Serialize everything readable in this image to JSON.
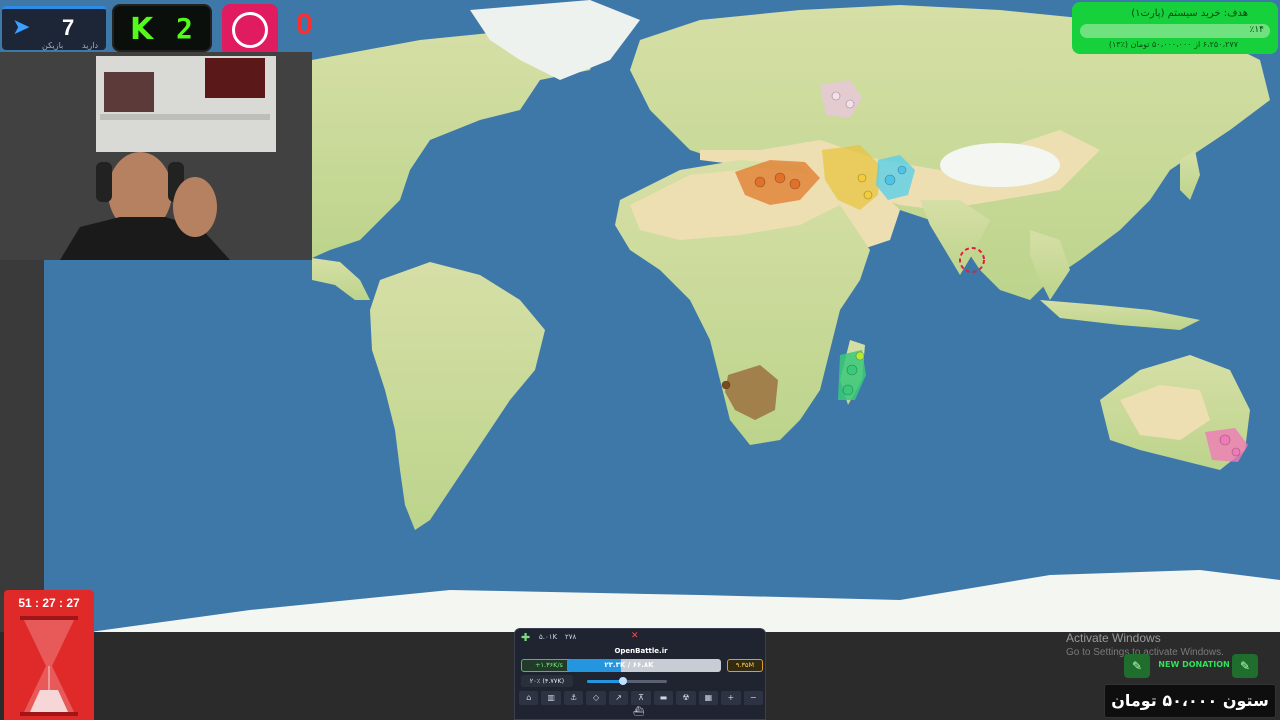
{
  "stream": {
    "viewer_count": "7",
    "viewer_label_1": "بازیکن",
    "viewer_label_2": "دارید",
    "kick_letter": "K",
    "kick_count": "2",
    "patreon_count": "0"
  },
  "goal": {
    "title": "هدف: خرید سیستم (پارت۱)",
    "percent": "٪۱۴",
    "amount": "۶،۲۵۰،۲۷۷ از ۵۰،۰۰۰،۰۰۰ تومان (٪۱۳)",
    "progress": 0.13
  },
  "timer": {
    "text": "51 : 27 : 27"
  },
  "game_panel": {
    "top_left_value": "۵.۰۱K",
    "top_mid_value": "۲۷۸",
    "close_glyph": "✕",
    "title": "OpenBattle.ir",
    "gold_rate": "+۱.۳۶K/s",
    "troops": "۲۳.۳K / ۶۶.۸K",
    "troops_fraction": 0.35,
    "gold": "۹.۳۵M",
    "attack_ratio": "۲۰٪ (۴.۷۷K)",
    "slider_fraction": 0.45
  },
  "watermark": {
    "line1": "Activate Windows",
    "line2": "Go to Settings to activate Windows."
  },
  "donation": {
    "label": "NEW DONATION",
    "donor_text": "ستون ۵۰،۰۰۰ تومان"
  },
  "colors": {
    "ocean": "#3d78a8",
    "land": "#c9d99a",
    "desert": "#eedfb2",
    "snow": "#f4f6f2",
    "goal_green": "#16d13b",
    "timer_red": "#e02a2a",
    "troop_blue": "#2496e0"
  }
}
